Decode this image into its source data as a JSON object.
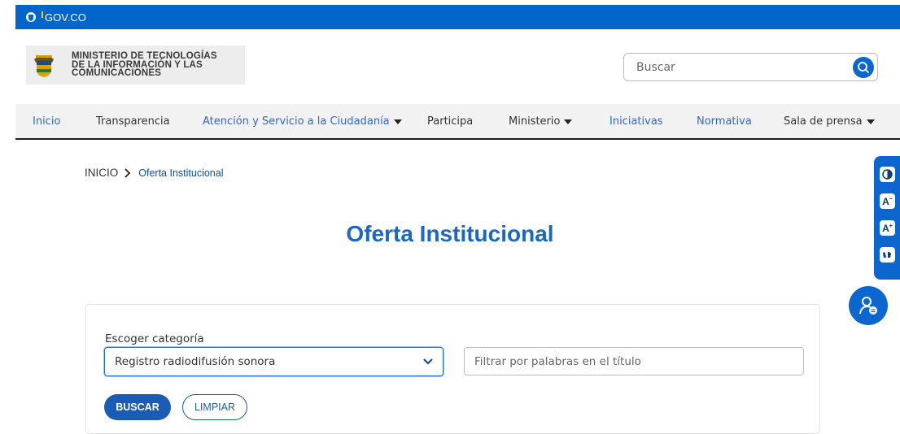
{
  "govbar": {
    "logo_text": "GOV.CO"
  },
  "header": {
    "ministry_lines": [
      "MINISTERIO DE TECNOLOGÍAS",
      "DE LA INFORMACIÓN Y LAS",
      "COMUNICACIONES"
    ],
    "search_placeholder": "Buscar"
  },
  "nav": {
    "items": [
      {
        "label": "Inicio"
      },
      {
        "label": "Transparencia"
      },
      {
        "label": "Atención y Servicio a la Ciudadanía"
      },
      {
        "label": "Participa"
      },
      {
        "label": "Ministerio"
      },
      {
        "label": "Iniciativas"
      },
      {
        "label": "Normativa"
      },
      {
        "label": "Sala de prensa"
      }
    ]
  },
  "breadcrumb": {
    "home": "INICIO",
    "current": "Oferta Institucional"
  },
  "page": {
    "title": "Oferta Institucional"
  },
  "filters": {
    "category_label": "Escoger categoría",
    "category_value": "Registro radiodifusión sonora",
    "keyword_placeholder": "Filtrar por palabras en el título",
    "search_button": "BUSCAR",
    "clear_button": "LIMPIAR"
  },
  "accessibility": {
    "icons": [
      "contrast-icon",
      "decrease-font-icon",
      "increase-font-icon",
      "sign-language-icon",
      "accessibility-assistant-icon"
    ],
    "decrease_label": "A",
    "increase_label": "A"
  },
  "colors": {
    "primary": "#0066cc",
    "title": "#1a67c4",
    "nav_link": "#3366cc",
    "button": "#1a5cb3"
  }
}
